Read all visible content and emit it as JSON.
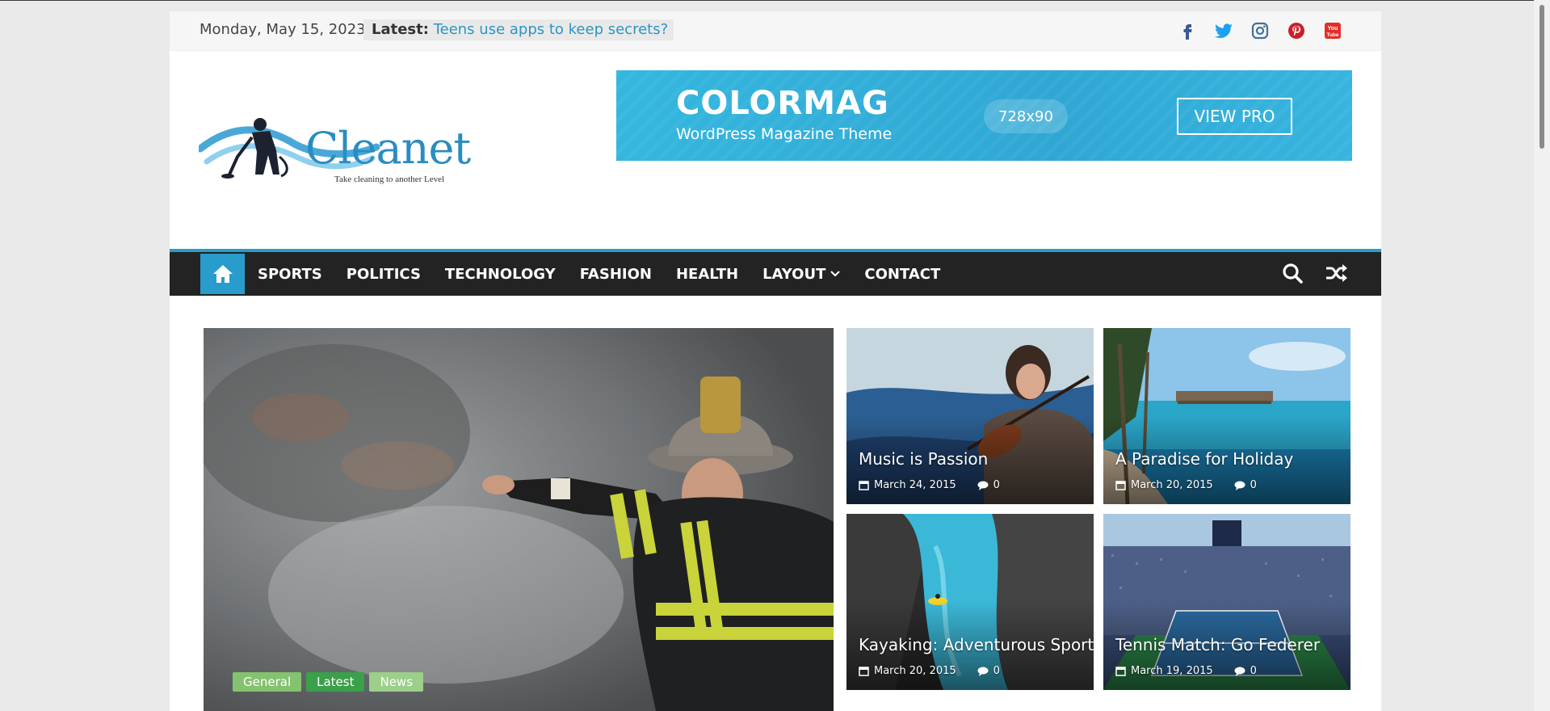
{
  "topbar": {
    "date": "Monday, May 15, 2023",
    "latest_label": "Latest:",
    "latest_text": "Teens use apps to keep secrets?",
    "socials": [
      "facebook-icon",
      "twitter-icon",
      "instagram-icon",
      "pinterest-icon",
      "youtube-icon"
    ]
  },
  "logo": {
    "word": "Cleanet",
    "tagline": "Take cleaning to another Level"
  },
  "banner": {
    "title": "COLORMAG",
    "subtitle": "WordPress Magazine Theme",
    "size": "728x90",
    "cta": "VIEW PRO"
  },
  "nav": {
    "items": [
      {
        "label": "SPORTS"
      },
      {
        "label": "POLITICS"
      },
      {
        "label": "TECHNOLOGY"
      },
      {
        "label": "FASHION"
      },
      {
        "label": "HEALTH"
      },
      {
        "label": "LAYOUT"
      },
      {
        "label": "CONTACT"
      }
    ]
  },
  "feature": {
    "categories": [
      "General",
      "Latest",
      "News"
    ]
  },
  "tiles": [
    {
      "title": "Music is Passion",
      "date": "March 24, 2015",
      "comments": "0"
    },
    {
      "title": "A Paradise for Holiday",
      "date": "March 20, 2015",
      "comments": "0"
    },
    {
      "title": "Kayaking: Adventurous Sport",
      "date": "March 20, 2015",
      "comments": "0"
    },
    {
      "title": "Tennis Match: Go Federer",
      "date": "March 19, 2015",
      "comments": "0"
    }
  ],
  "colors": {
    "accent": "#289dcc",
    "nav_bg": "#232323",
    "cat_general": "#85c26f",
    "cat_latest": "#3aa04a",
    "cat_news": "#9ccf8a"
  }
}
